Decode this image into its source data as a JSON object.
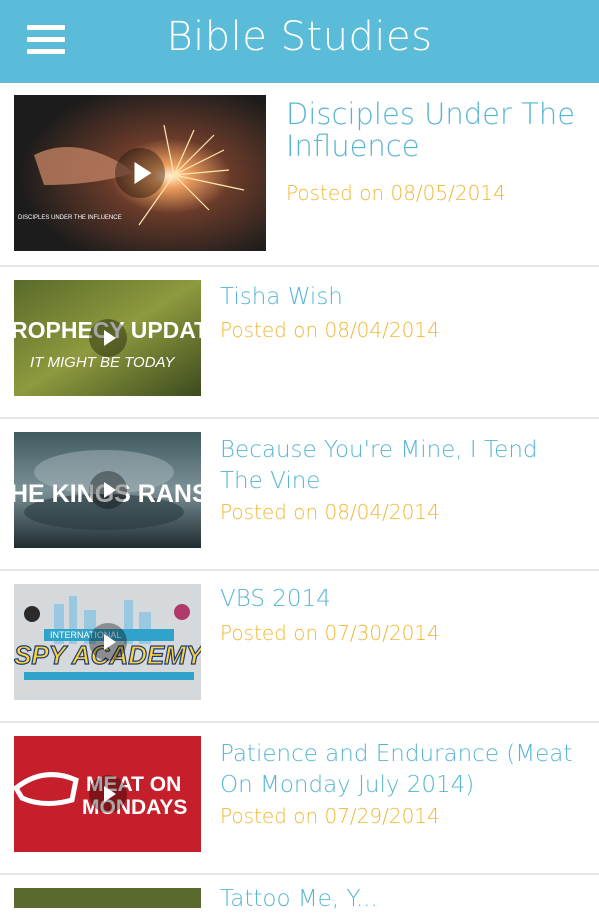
{
  "header": {
    "title": "Bible Studies",
    "bar_color": "#5bbcd9",
    "menu_icon": "hamburger-menu-icon"
  },
  "colors": {
    "title": "#55b6d3",
    "date": "#f2b632",
    "divider": "#e6e6e6"
  },
  "studies": [
    {
      "title": "Disciples Under The Influence",
      "date": "Posted on 08/05/2014",
      "thumb_text": "DISCIPLES UNDER THE INFLUENCE"
    },
    {
      "title": "Tisha Wish",
      "date": "Posted on 08/04/2014",
      "thumb_text": "ROPHECY UPDAT",
      "thumb_sub": "IT MIGHT BE TODAY"
    },
    {
      "title": "Because You're Mine, I Tend The Vine",
      "date": "Posted on 08/04/2014",
      "thumb_text": "HE KINGS RANSO"
    },
    {
      "title": "VBS 2014",
      "date": "Posted on 07/30/2014",
      "thumb_text": "SPY ACADEMY",
      "thumb_sub": "INTERNATIONAL"
    },
    {
      "title": "Patience and Endurance (Meat On Monday July 2014)",
      "date": "Posted on 07/29/2014",
      "thumb_text": "MEAT ON",
      "thumb_sub": "MONDAYS"
    },
    {
      "title": "Tattoo Me, Y...",
      "date": "",
      "thumb_text": ""
    }
  ]
}
